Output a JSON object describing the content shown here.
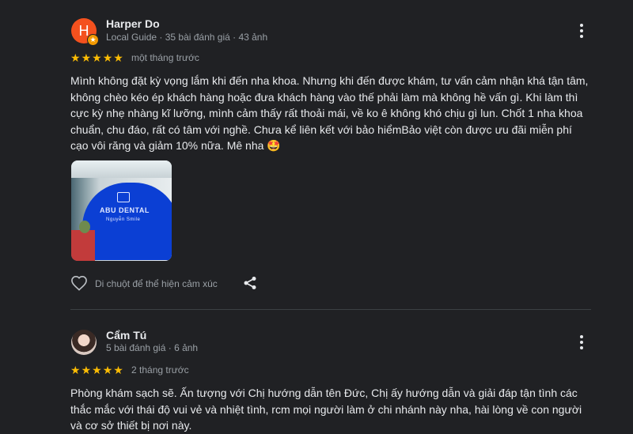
{
  "reviews": [
    {
      "avatar_letter": "H",
      "name": "Harper Do",
      "meta": "Local Guide · 35 bài đánh giá · 43 ảnh",
      "rating": 5,
      "date": "một tháng trước",
      "text": "Mình không đặt kỳ vọng lắm khi đến nha khoa. Nhưng khi đến được khám, tư vấn cảm nhận khá tận tâm, không chèo kéo ép khách hàng hoặc đưa khách hàng vào thế phải làm mà không hề vấn gì. Khi làm thì cực kỳ nhẹ nhàng kĩ lưỡng, mình cảm thấy rất thoải mái, về ko ê không khó chịu gì lun. Chốt 1 nha khoa chuẩn, chu đáo, rất có tâm với nghề. Chưa kể liên kết với bảo hiểmBảo việt còn được ưu đãi miễn phí cạo vôi răng và giảm 10% nữa. Mê nha 🤩",
      "photo_brand": "ABU DENTAL",
      "photo_sub": "Nguyễn Smile",
      "like_label": "Di chuột để thể hiện cảm xúc"
    },
    {
      "name": "Cẩm Tú",
      "meta": "5 bài đánh giá · 6 ảnh",
      "rating": 5,
      "date": "2 tháng trước",
      "text": "Phòng khám sạch sẽ. Ấn tượng với Chị hướng dẫn tên Đức, Chị ấy hướng dẫn và giải đáp tận tình các thắc mắc với thái độ vui vẻ và nhiệt tình, rcm mọi người làm ở chi nhánh này nha, hài lòng về con người và cơ sở thiết bị nơi này."
    }
  ],
  "colors": {
    "background": "#202124",
    "star": "#fbbc04",
    "avatar": "#f4511e",
    "guide_badge": "#f29900"
  },
  "icons": [
    "more-vert-icon",
    "star-icon",
    "heart-outline-icon",
    "share-icon",
    "local-guide-badge-icon"
  ]
}
